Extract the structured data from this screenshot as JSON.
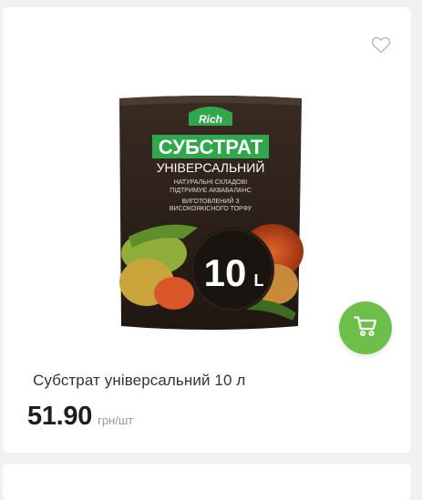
{
  "product": {
    "name": "Субстрат універсальний 10 л",
    "price": "51.90",
    "unit": "грн/шт"
  },
  "package": {
    "brand": "Rich",
    "title": "СУБСТРАТ",
    "subtitle": "УНІВЕРСАЛЬНИЙ",
    "lines": [
      "НАТУРАЛЬНІ СКЛАДОВІ",
      "ПІДТРИМУЄ АКВАБАЛАНС",
      "ВИГОТОВЛЕНИЙ З",
      "ВИСОКОЯКІСНОГО ТОРФУ"
    ],
    "volume": "10",
    "volume_unit": "L"
  },
  "icons": {
    "favorite": "heart-outline-icon",
    "cart": "cart-icon"
  },
  "colors": {
    "accent": "#6cc04a",
    "package_band": "#2ea84a",
    "package_bg": "#2a1e18"
  }
}
